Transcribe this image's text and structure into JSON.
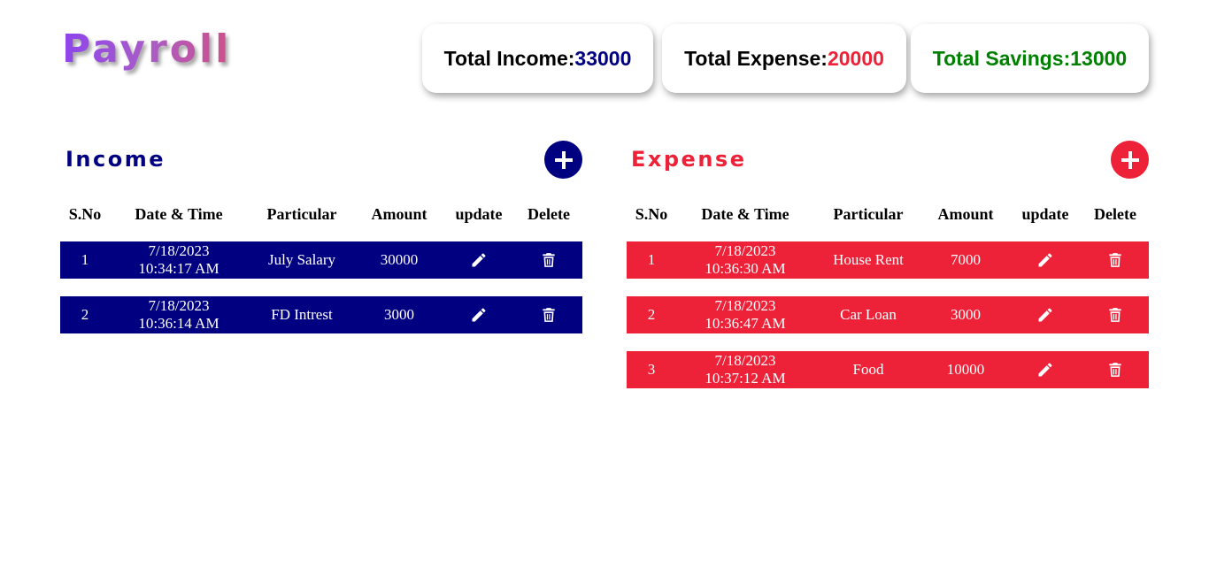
{
  "app": {
    "title": "Payroll"
  },
  "summary": {
    "income_label": "Total Income:",
    "income_value": "33000",
    "expense_label": "Total Expense:",
    "expense_value": "20000",
    "savings_label": "Total Savings:",
    "savings_value": "13000"
  },
  "colors": {
    "income": "#000080",
    "expense": "#ed2137",
    "savings": "#008000"
  },
  "columns": [
    "S.No",
    "Date & Time",
    "Particular",
    "Amount",
    "update",
    "Delete"
  ],
  "icons": {
    "add": "plus-circle-icon",
    "update": "pencil-icon",
    "delete": "trash-icon"
  },
  "income": {
    "title": "Income",
    "rows": [
      {
        "sno": "1",
        "date": "7/18/2023",
        "time": "10:34:17 AM",
        "particular": "July Salary",
        "amount": "30000"
      },
      {
        "sno": "2",
        "date": "7/18/2023",
        "time": "10:36:14 AM",
        "particular": "FD Intrest",
        "amount": "3000"
      }
    ]
  },
  "expense": {
    "title": "Expense",
    "rows": [
      {
        "sno": "1",
        "date": "7/18/2023",
        "time": "10:36:30 AM",
        "particular": "House Rent",
        "amount": "7000"
      },
      {
        "sno": "2",
        "date": "7/18/2023",
        "time": "10:36:47 AM",
        "particular": "Car Loan",
        "amount": "3000"
      },
      {
        "sno": "3",
        "date": "7/18/2023",
        "time": "10:37:12 AM",
        "particular": "Food",
        "amount": "10000"
      }
    ]
  }
}
